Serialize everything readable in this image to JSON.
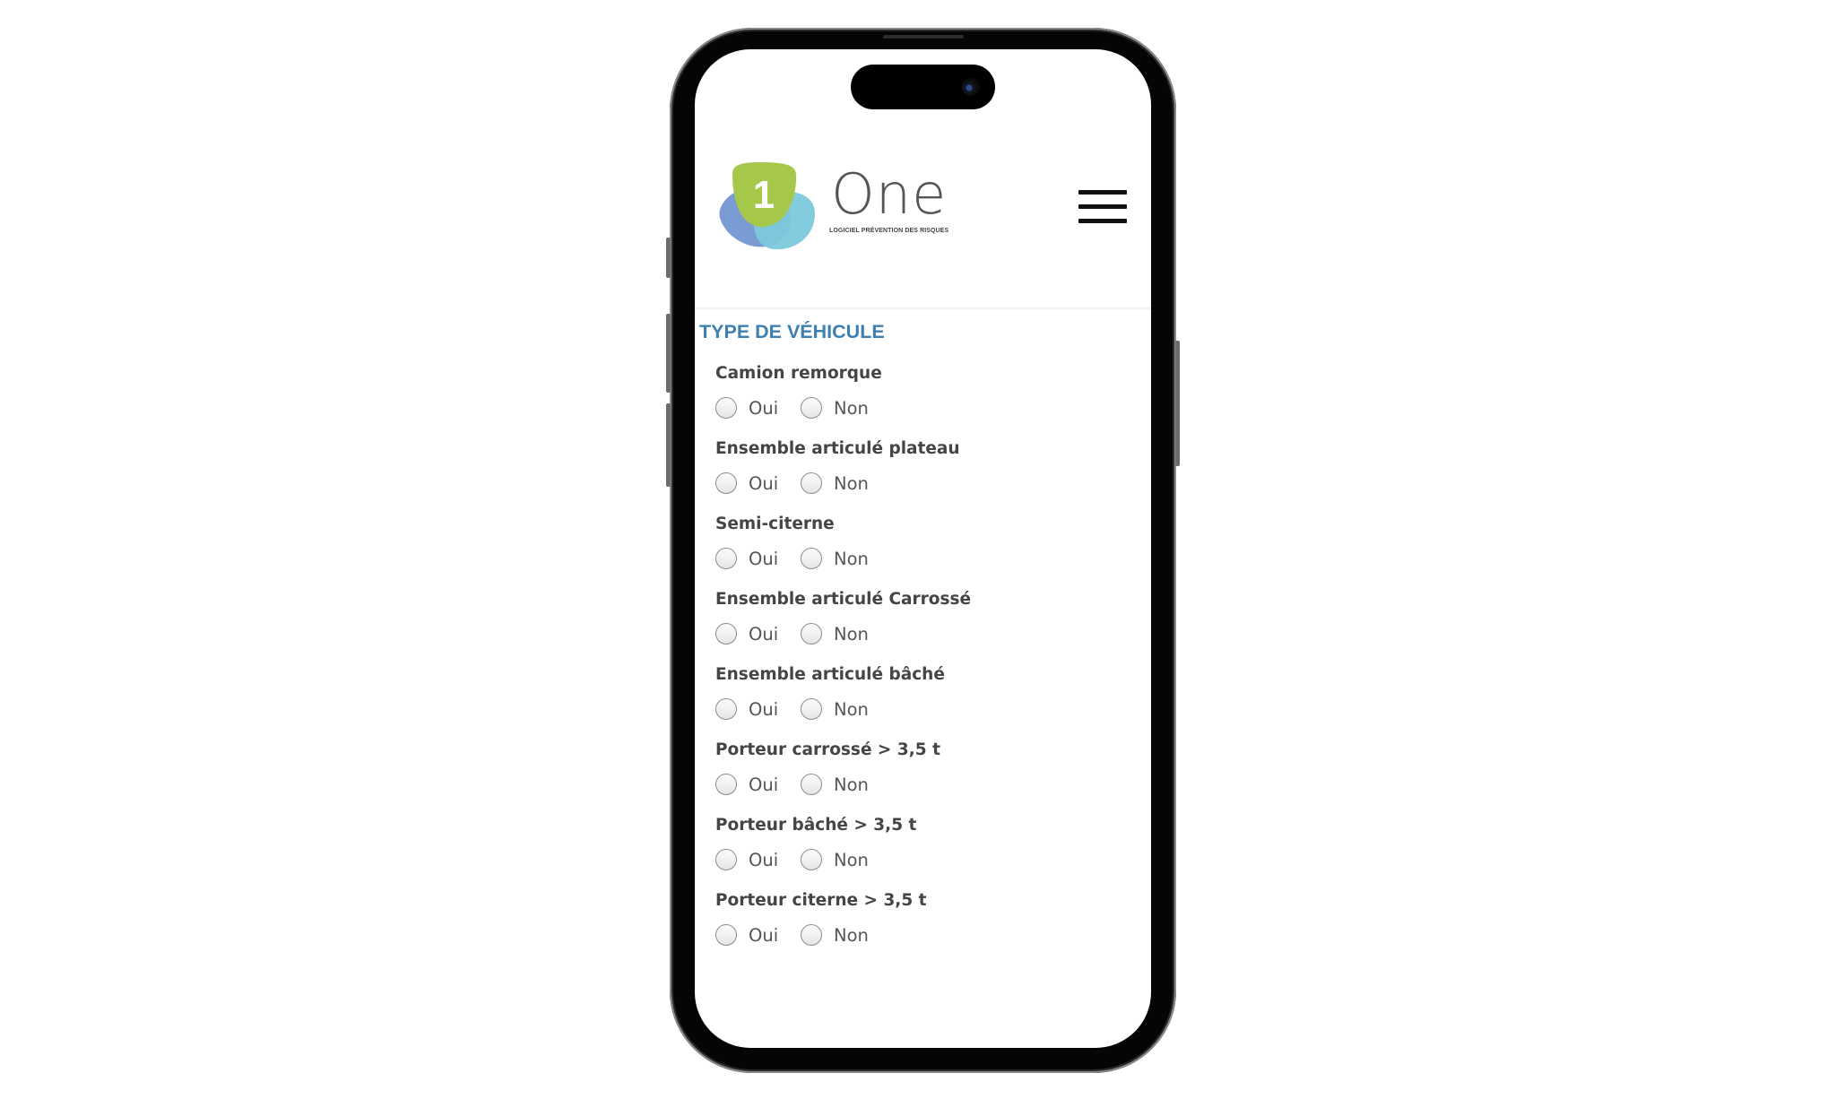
{
  "app": {
    "logo_digit": "1",
    "logo_word": "One",
    "logo_tagline": "LOGICIEL PRÉVENTION DES RISQUES",
    "menu_icon": "hamburger-menu-icon"
  },
  "colors": {
    "logo_green": "#a5c84a",
    "logo_blue": "#7a9bd4",
    "logo_cyan": "#7cc9dc",
    "section_title": "#3e7fb1"
  },
  "section": {
    "title": "TYPE DE VÉHICULE",
    "questions": [
      {
        "label": "Camion remorque",
        "options": [
          "Oui",
          "Non"
        ],
        "selected": null
      },
      {
        "label": "Ensemble articulé plateau",
        "options": [
          "Oui",
          "Non"
        ],
        "selected": null
      },
      {
        "label": "Semi-citerne",
        "options": [
          "Oui",
          "Non"
        ],
        "selected": null
      },
      {
        "label": "Ensemble articulé Carrossé",
        "options": [
          "Oui",
          "Non"
        ],
        "selected": null
      },
      {
        "label": "Ensemble articulé bâché",
        "options": [
          "Oui",
          "Non"
        ],
        "selected": null
      },
      {
        "label": "Porteur carrossé > 3,5 t",
        "options": [
          "Oui",
          "Non"
        ],
        "selected": null
      },
      {
        "label": "Porteur bâché > 3,5 t",
        "options": [
          "Oui",
          "Non"
        ],
        "selected": null
      },
      {
        "label": "Porteur citerne > 3,5 t",
        "options": [
          "Oui",
          "Non"
        ],
        "selected": null
      }
    ]
  }
}
